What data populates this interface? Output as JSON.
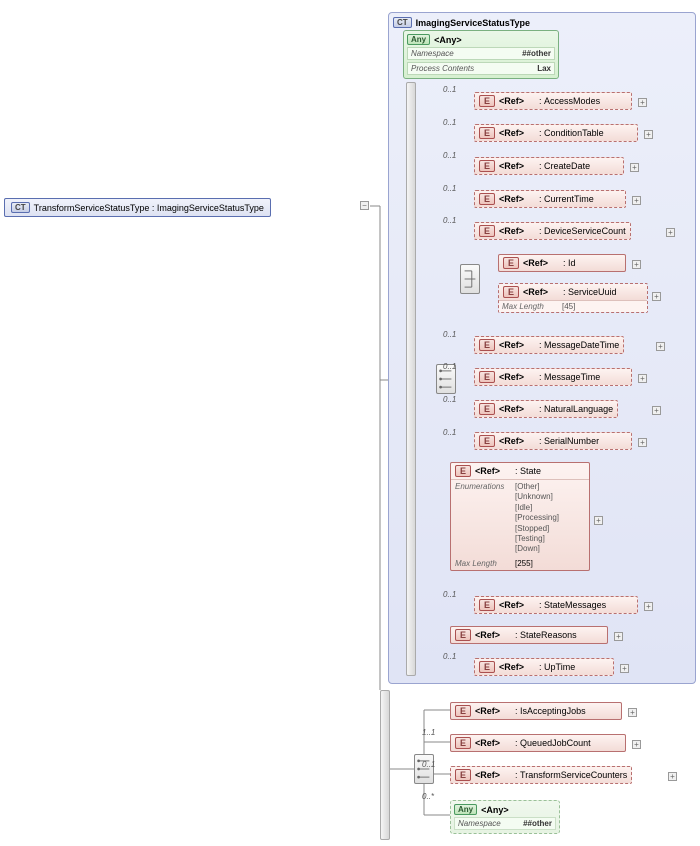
{
  "root": {
    "badge": "CT",
    "name": "TransformServiceStatusType : ImagingServiceStatusType"
  },
  "group": {
    "badge": "CT",
    "name": "ImagingServiceStatusType"
  },
  "anyTop": {
    "label": "<Any>",
    "ns_k": "Namespace",
    "ns_v": "##other",
    "pc_k": "Process Contents",
    "pc_v": "Lax"
  },
  "refLabel": "<Ref>",
  "refs": {
    "accessModes": "AccessModes",
    "conditionTable": "ConditionTable",
    "createDate": "CreateDate",
    "currentTime": "CurrentTime",
    "deviceServiceCount": "DeviceServiceCount",
    "id": "Id",
    "serviceUuid": "ServiceUuid",
    "serviceUuid_ml_k": "Max Length",
    "serviceUuid_ml_v": "[45]",
    "messageDateTime": "MessageDateTime",
    "messageTime": "MessageTime",
    "naturalLanguage": "NaturalLanguage",
    "serialNumber": "SerialNumber",
    "state": "State",
    "stateMessages": "StateMessages",
    "stateReasons": "StateReasons",
    "upTime": "UpTime",
    "isAcceptingJobs": "IsAcceptingJobs",
    "queuedJobCount": "QueuedJobCount",
    "transformServiceCounters": "TransformServiceCounters"
  },
  "state": {
    "enum_k": "Enumerations",
    "enums": [
      "[Other]",
      "[Unknown]",
      "[Idle]",
      "[Processing]",
      "[Stopped]",
      "[Testing]",
      "[Down]"
    ],
    "ml_k": "Max Length",
    "ml_v": "[255]"
  },
  "anyBottom": {
    "label": "<Any>",
    "ns_k": "Namespace",
    "ns_v": "##other"
  },
  "card": {
    "c01": "0..1",
    "c11": "1..1",
    "c0s": "0..*"
  },
  "colon": ":"
}
